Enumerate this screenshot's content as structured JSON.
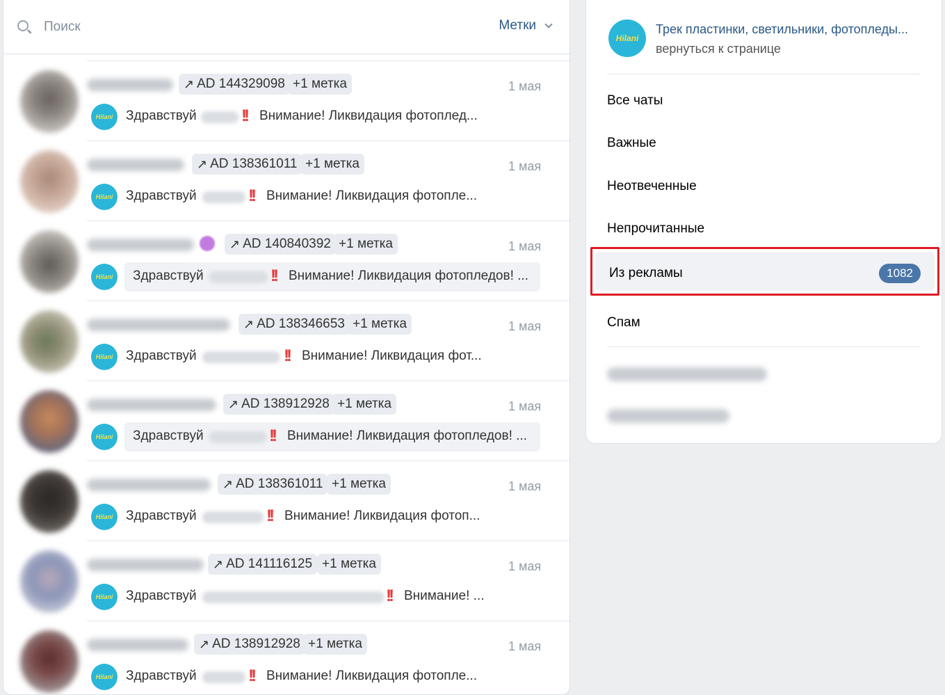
{
  "search": {
    "placeholder": "Поиск",
    "labels_button": "Метки"
  },
  "conversations": [
    {
      "ad": "AD 144329098",
      "more": "+1 метка",
      "date": "1 мая",
      "greeting": "Здравствуй",
      "text": "Внимание! Ликвидация фотоплед..."
    },
    {
      "ad": "AD 138361011",
      "more": "+1 метка",
      "date": "1 мая",
      "greeting": "Здравствуй",
      "text": "Внимание! Ликвидация фотопле..."
    },
    {
      "ad": "AD 140840392",
      "more": "+1 метка",
      "date": "1 мая",
      "greeting": "Здравствуй",
      "text": "Внимание! Ликвидация фотопледов! ..."
    },
    {
      "ad": "AD 138346653",
      "more": "+1 метка",
      "date": "1 мая",
      "greeting": "Здравствуй",
      "text": "Внимание! Ликвидация фот..."
    },
    {
      "ad": "AD 138912928",
      "more": "+1 метка",
      "date": "1 мая",
      "greeting": "Здравствуй",
      "text": "Внимание! Ликвидация фотопледов! ..."
    },
    {
      "ad": "AD 138361011",
      "more": "+1 метка",
      "date": "1 мая",
      "greeting": "Здравствуй",
      "text": "Внимание! Ликвидация фотоп..."
    },
    {
      "ad": "AD 141116125",
      "more": "+1 метка",
      "date": "1 мая",
      "greeting": "Здравствуй",
      "text": "Внимание! ..."
    },
    {
      "ad": "AD 138912928",
      "more": "+1 метка",
      "date": "1 мая",
      "greeting": "Здравствуй",
      "text": "Внимание! Ликвидация фотопле..."
    }
  ],
  "group": {
    "title": "Трек пластинки, светильники, фотопледы...",
    "back_link": "вернуться к странице",
    "logo_text": "Hilani"
  },
  "filters": {
    "all": "Все чаты",
    "important": "Важные",
    "unanswered": "Неотвеченные",
    "unread": "Непрочитанные",
    "from_ads": "Из рекламы",
    "from_ads_count": "1082",
    "spam": "Спам"
  },
  "colors": {
    "accent": "#4a76a8",
    "link": "#2a5885",
    "highlight_border": "#e01b24",
    "logo_bg": "#2ab6d8"
  },
  "icons": {
    "search": "search-icon",
    "chevron": "chevron-down-icon",
    "ad_arrow": "arrow-up-right-icon",
    "alarm": "double-exclamation-icon"
  }
}
